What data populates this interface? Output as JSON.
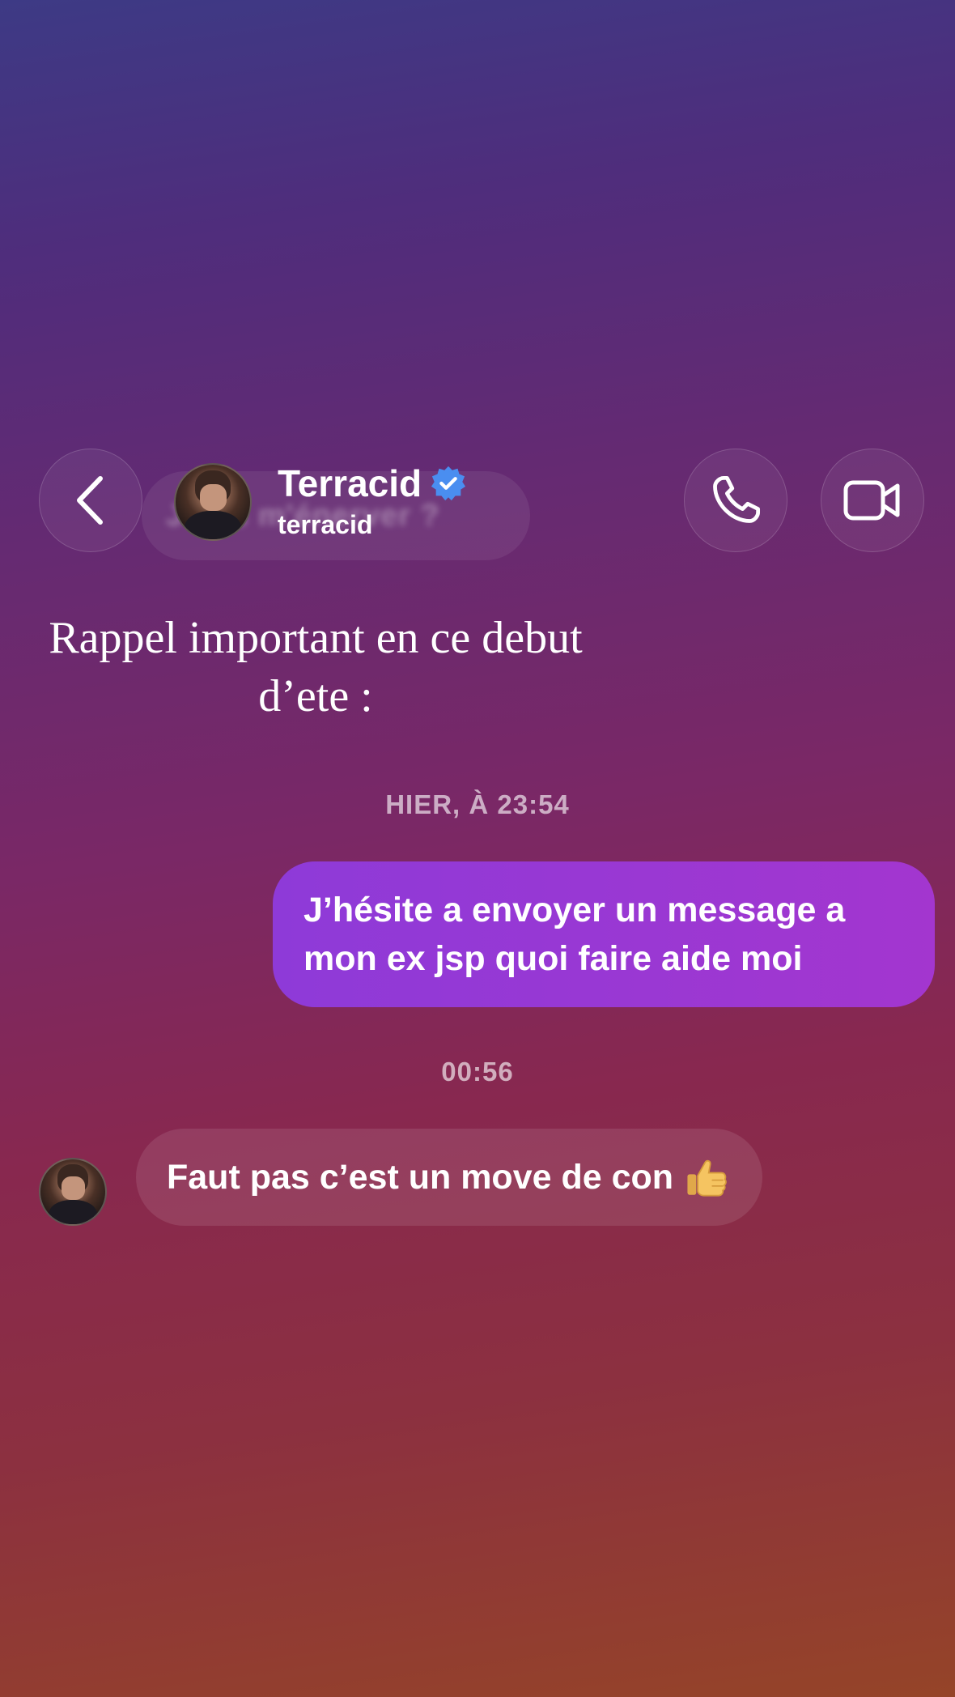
{
  "header": {
    "contact_name": "Terracid",
    "contact_username": "terracid",
    "background_ghost_text": "Jsuis m'énerver ?",
    "back_icon": "chevron-left-icon",
    "call_icon": "phone-icon",
    "video_icon": "video-camera-icon",
    "verified_icon": "verified-badge-icon"
  },
  "caption": {
    "line1": "Rappel important en ce debut",
    "line2": "d’ete :"
  },
  "conversation": {
    "timestamps": [
      "HIER, À 23:54",
      "00:56"
    ],
    "messages": [
      {
        "direction": "sent",
        "line1": "J’hésite a envoyer un message a",
        "line2": "mon ex jsp quoi faire aide moi"
      },
      {
        "direction": "received",
        "text": "Faut pas c’est un move de con",
        "emoji": "thumbs-up-icon"
      }
    ]
  },
  "colors": {
    "sent_bubble": "#a336cf",
    "verified_badge": "#4a8ef0"
  }
}
